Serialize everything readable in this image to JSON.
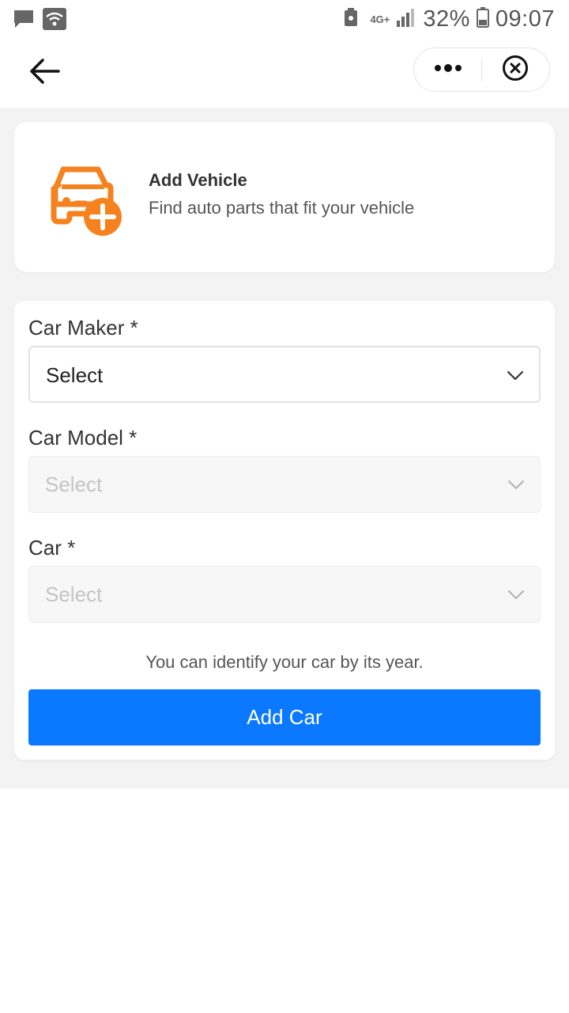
{
  "status_bar": {
    "left_icons": [
      "chat-bubble-icon",
      "wifi-icon"
    ],
    "network": "4G+",
    "battery_percent": "32%",
    "time": "09:07"
  },
  "nav": {
    "back_icon": "arrow-left-icon",
    "more_icon": "more-dots-icon",
    "close_icon": "close-circle-icon"
  },
  "banner": {
    "icon": "car-plus-icon",
    "accent_color": "#f5821f",
    "title": "Add Vehicle",
    "subtitle": "Find auto parts that fit your vehicle"
  },
  "form": {
    "fields": [
      {
        "label": "Car Maker *",
        "value": "Select",
        "enabled": true
      },
      {
        "label": "Car Model *",
        "value": "Select",
        "enabled": false
      },
      {
        "label": "Car *",
        "value": "Select",
        "enabled": false
      }
    ],
    "hint": "You can identify your car by its year.",
    "submit_label": "Add Car",
    "submit_color": "#0a78ff"
  }
}
